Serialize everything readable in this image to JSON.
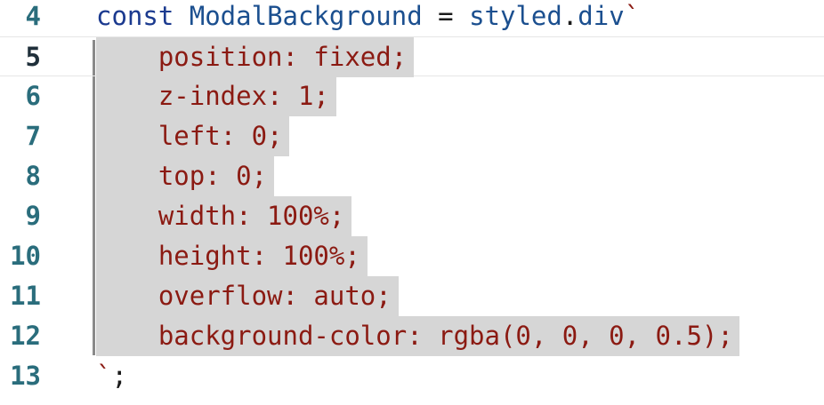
{
  "editor": {
    "current_line": "5",
    "lines": [
      {
        "number": "4",
        "parts": [
          {
            "t": "const ",
            "c": "kw"
          },
          {
            "t": "ModalBackground",
            "c": "id"
          },
          {
            "t": " = ",
            "c": "plain"
          },
          {
            "t": "styled",
            "c": "id"
          },
          {
            "t": ".",
            "c": "plain"
          },
          {
            "t": "div",
            "c": "id"
          },
          {
            "t": "`",
            "c": "str"
          }
        ],
        "selected": false
      },
      {
        "number": "5",
        "parts": [
          {
            "t": "    position: fixed;",
            "c": "str"
          }
        ],
        "selected": true
      },
      {
        "number": "6",
        "parts": [
          {
            "t": "    z-index: 1;",
            "c": "str"
          }
        ],
        "selected": true
      },
      {
        "number": "7",
        "parts": [
          {
            "t": "    left: 0;",
            "c": "str"
          }
        ],
        "selected": true
      },
      {
        "number": "8",
        "parts": [
          {
            "t": "    top: 0;",
            "c": "str"
          }
        ],
        "selected": true
      },
      {
        "number": "9",
        "parts": [
          {
            "t": "    width: 100%;",
            "c": "str"
          }
        ],
        "selected": true
      },
      {
        "number": "10",
        "parts": [
          {
            "t": "    height: 100%;",
            "c": "str"
          }
        ],
        "selected": true
      },
      {
        "number": "11",
        "parts": [
          {
            "t": "    overflow: auto;",
            "c": "str"
          }
        ],
        "selected": true
      },
      {
        "number": "12",
        "parts": [
          {
            "t": "    background-color: rgba(0, 0, 0, 0.5);",
            "c": "str"
          }
        ],
        "selected": true
      },
      {
        "number": "13",
        "parts": [
          {
            "t": "`",
            "c": "str"
          },
          {
            "t": ";",
            "c": "plain"
          }
        ],
        "selected": false
      }
    ]
  },
  "colors": {
    "selection": "#d6d6d6",
    "string": "#8b1a12",
    "keyword": "#1b3a8f",
    "line_number": "#2a6d7c"
  }
}
